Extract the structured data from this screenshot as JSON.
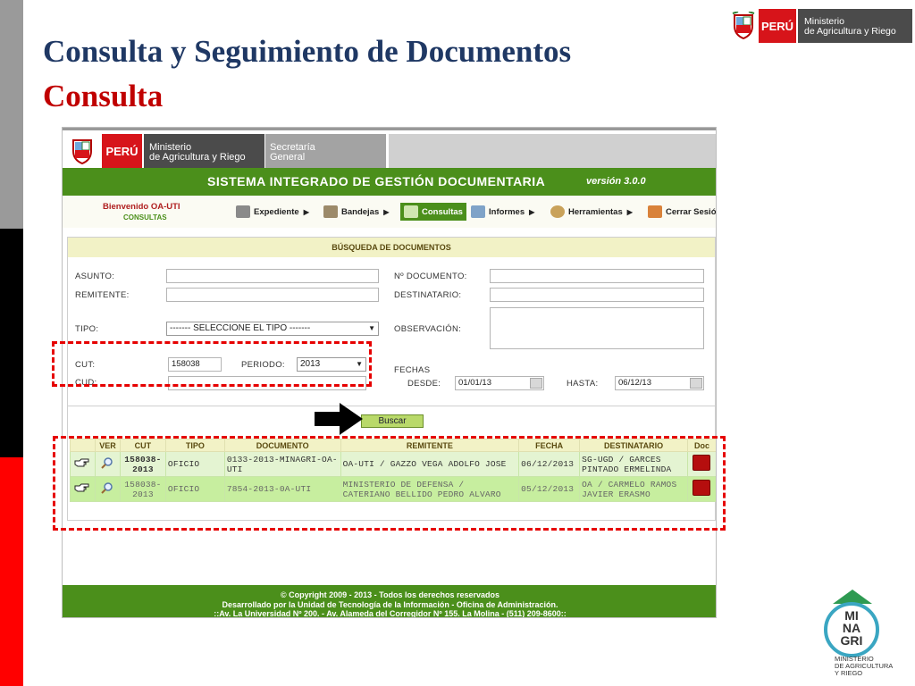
{
  "slide": {
    "title": "Consulta y Seguimiento de Documentos",
    "subtitle": "Consulta",
    "colors": {
      "title": "#1f3864",
      "subtitle": "#c00000",
      "bar_gray": "#9a9a9a",
      "bar_black": "#000000",
      "bar_red": "#ff0000"
    }
  },
  "top_logo": {
    "peru": "PERÚ",
    "ministry_line1": "Ministerio",
    "ministry_line2": "de Agricultura y Riego"
  },
  "bottom_logo": {
    "mark_line1": "MI",
    "mark_line2": "NA",
    "mark_line3": "GRI",
    "caption_line1": "MINISTERIO",
    "caption_line2": "DE AGRICULTURA",
    "caption_line3": "Y RIEGO"
  },
  "app": {
    "header": {
      "peru": "PERÚ",
      "ministry_line1": "Ministerio",
      "ministry_line2": "de Agricultura y Riego",
      "secretaria_line1": "Secretaría",
      "secretaria_line2": "General"
    },
    "system_title": "SISTEMA INTEGRADO DE GESTIÓN DOCUMENTARIA",
    "version": "versión 3.0.0",
    "welcome": "Bienvenido OA-UTI",
    "welcome_sub": "CONSULTAS",
    "menu": [
      {
        "label": "Expediente",
        "icon": "folder-icon"
      },
      {
        "label": "Bandejas",
        "icon": "inbox-icon"
      },
      {
        "label": "Consultas",
        "icon": "search-docs-icon",
        "active": true
      },
      {
        "label": "Informes",
        "icon": "printer-icon"
      },
      {
        "label": "Herramientas",
        "icon": "gear-icon"
      },
      {
        "label": "Cerrar Sesión",
        "icon": "home-icon"
      }
    ],
    "search": {
      "title": "BÚSQUEDA DE DOCUMENTOS",
      "asunto_label": "ASUNTO:",
      "asunto_value": "",
      "remitente_label": "REMITENTE:",
      "remitente_value": "",
      "tipo_label": "TIPO:",
      "tipo_value": "------- SELECCIONE EL TIPO -------",
      "cut_label": "CUT:",
      "cut_value": "158038",
      "periodo_label": "PERIODO:",
      "periodo_value": "2013",
      "cud_label": "CUD:",
      "cud_value": "",
      "nro_label": "Nº DOCUMENTO:",
      "nro_value": "",
      "destinatario_label": "DESTINATARIO:",
      "destinatario_value": "",
      "observacion_label": "OBSERVACIÓN:",
      "observacion_value": "",
      "fechas_label": "FECHAS",
      "desde_label": "DESDE:",
      "desde_value": "01/01/13",
      "hasta_label": "HASTA:",
      "hasta_value": "06/12/13",
      "button": "Buscar"
    },
    "table": {
      "columns": [
        "",
        "VER",
        "CUT",
        "TIPO",
        "DOCUMENTO",
        "REMITENTE",
        "FECHA",
        "DESTINATARIO",
        "Doc"
      ],
      "rows": [
        {
          "cut": "158038-2013",
          "tipo": "OFICIO",
          "documento": "0133-2013-MINAGRI-OA-UTI",
          "remitente": "OA-UTI / GAZZO VEGA ADOLFO JOSE",
          "fecha": "06/12/2013",
          "destinatario": "SG-UGD / GARCES PINTADO ERMELINDA"
        },
        {
          "cut": "158038-2013",
          "tipo": "OFICIO",
          "documento": "7854-2013-0A-UTI",
          "remitente": "MINISTERIO DE DEFENSA / CATERIANO BELLIDO PEDRO ALVARO",
          "fecha": "05/12/2013",
          "destinatario": "OA / CARMELO RAMOS JAVIER ERASMO"
        }
      ]
    },
    "footer": {
      "line1": "© Copyright 2009 - 2013 - Todos los derechos reservados",
      "line2": "Desarrollado por la Unidad de Tecnología de la Información - Oficina de Administración.",
      "line3": "::Av. La Universidad Nº 200. - Av. Alameda del Corregidor Nº 155. La Molina - (511) 209-8600::"
    },
    "colors": {
      "green": "#4b8f1b",
      "header_bar": "#f2f2c6",
      "row1": "#e4f4d2",
      "row2": "#c7ee9f",
      "pdf": "#b50e0e",
      "peru_red": "#d7141a",
      "highlight": "#e60000"
    }
  }
}
